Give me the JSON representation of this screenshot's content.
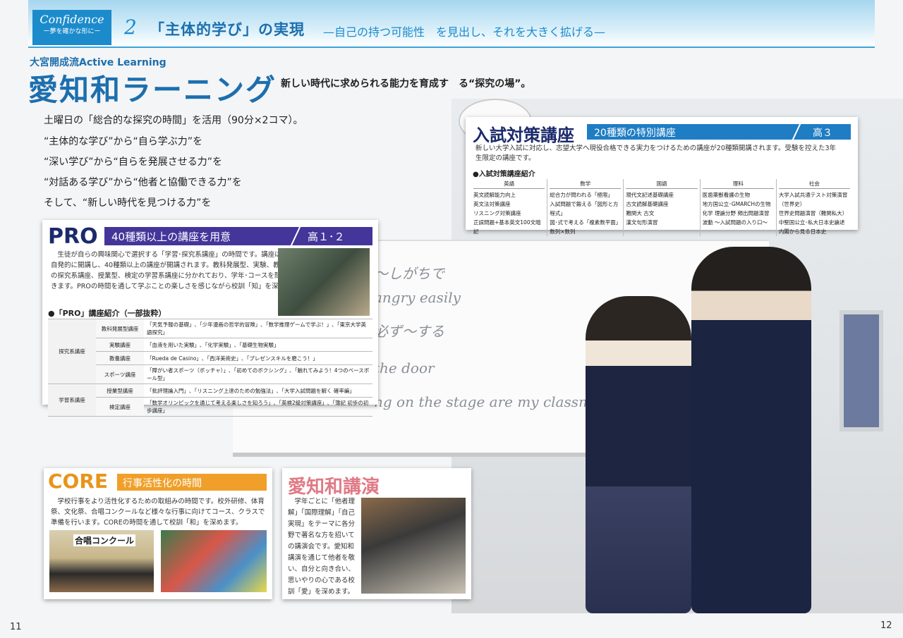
{
  "header": {
    "logo_title": "Confidence",
    "logo_sub": "ー夢を確かな形にー",
    "chapter_number": "2",
    "chapter_title": "「主体的学び」の実現",
    "chapter_subtitle": "—自己の持つ可能性　を見出し、それを大きく拡げる—"
  },
  "intro": {
    "brand": "大宮開成流Active Learning",
    "title": "愛知和ラーニング",
    "tagline": "新しい時代に求められる能力を育成す　る“探究の場”。",
    "lines": [
      "土曜日の「総合的な探究の時間」を活用（90分×2コマ）。",
      "“主体的な学び”から“自ら学ぶ力”を",
      "“深い学び”から“自らを発展させる力”を",
      "“対話ある学び”から“他者と協働できる力”を",
      "そして、“新しい時代を見つける力”を"
    ]
  },
  "whiteboard": {
    "lines": [
      "〜しがちで",
      "angry easily",
      "必ず〜する",
      "the door",
      "ng on the stage are my classmates"
    ]
  },
  "pro": {
    "label": "PRO",
    "band_text": "40種類以上の講座を用意",
    "grade": "高１･２",
    "description": "生徒が自らの興味関心で選択する「学習･探究系講座」の時間です。講座は本校教員が自発的に開講し、40種類以上の講座が開講されます。教科発展型、実験、教養、スポーツの探究系講座、授業型、検定の学習系講座に分かれており、学年･コースを問わず選択できます。PROの時間を通して学ぶことの楽しさを感じながら校訓「知」を深めます。",
    "sub_heading": "●「PRO」講座紹介（一部抜粋）",
    "rows": [
      {
        "group": "探究系講座",
        "type": "教科発展型講座",
        "content": "「天気予報の基礎」､「少年漫画の哲学的冒険」､「数学推理ゲームで学ぶ！」､「東京大学英語探究」"
      },
      {
        "group": "",
        "type": "実験講座",
        "content": "「血液を用いた実験」､「化学実験」､「基礎生物実験」"
      },
      {
        "group": "",
        "type": "教養講座",
        "content": "「Rueda de Casino」､「西洋美術史」､「プレゼンスキルを磨こう！」"
      },
      {
        "group": "",
        "type": "スポーツ講座",
        "content": "「障がい者スポーツ（ボッチャ）」､「初めてのボクシング」､「触れてみよう！4つのベースボール型」"
      },
      {
        "group": "学習系講座",
        "type": "授業型講座",
        "content": "「批評理論入門」､「リスニング上達のための勉強法」､「大学入試問題を解く 確率編」"
      },
      {
        "group": "",
        "type": "検定講座",
        "content": "「数学オリンピックを通じて考える楽しさを知ろう」､「英検2級対策講座」､「簿記 初歩の初歩講座」"
      }
    ]
  },
  "exam": {
    "label": "入試対策講座",
    "band_text": "20種類の特別講座",
    "grade": "高３",
    "description": "新しい大学入試に対応し、志望大学へ現役合格できる実力をつけるための講座が20種類開講されます。受験を控えた3年生限定の講座です。",
    "sub_heading": "●入試対策講座紹介",
    "columns": [
      {
        "subject": "英語",
        "items": [
          "英文読解能力向上",
          "英文法対策講座",
          "リスニング対策講座",
          "正誤問題+基本英文100文暗記"
        ]
      },
      {
        "subject": "数学",
        "items": [
          "総合力が問われる「極限」",
          "入試問題で鍛える「図形と方程式」",
          "図･式で考える「複素数平面」",
          "数列×数列"
        ]
      },
      {
        "subject": "国語",
        "items": [
          "現代文記述基礎講座",
          "古文読解基礎講座",
          "難関大 古文",
          "漢文句形演習"
        ]
      },
      {
        "subject": "理科",
        "items": [
          "医歯薬獣看護の生物",
          "地方国公立･GMARCHの生物",
          "化学 理論分野 頻出問題演習",
          "波動 〜入試問題の入り口〜"
        ]
      },
      {
        "subject": "社会",
        "items": [
          "大学入試共通テスト対策演習（世界史）",
          "世界史問題演習（難関私大）",
          "中堅国公立･私大日本史論述",
          "内閣から見る日本史"
        ]
      }
    ]
  },
  "core": {
    "label": "CORE",
    "band_text": "行事活性化の時間",
    "description": "学校行事をより活性化するための取組みの時間です。校外研修、体育祭、文化祭、合唱コンクールなど様々な行事に向けてコース、クラスで準備を行います。COREの時間を通して校訓「和」を深めます。",
    "photo_caption": "合唱コンクール"
  },
  "lecture": {
    "label": "愛知和講演",
    "description": "学年ごとに「他者理解」「国際理解」「自己実現」をテーマに各分野で著名な方を招いての講演会です。愛知和講演を通じて他者を敬い、自分と向き合い、思いやりの心である校訓「愛」を深めます。"
  },
  "pages": {
    "left": "11",
    "right": "12"
  },
  "colors": {
    "blue": "#1c6fae",
    "pro_purple": "#43359a",
    "core_orange": "#f0a02a",
    "lecture_pink": "#e07a86"
  }
}
